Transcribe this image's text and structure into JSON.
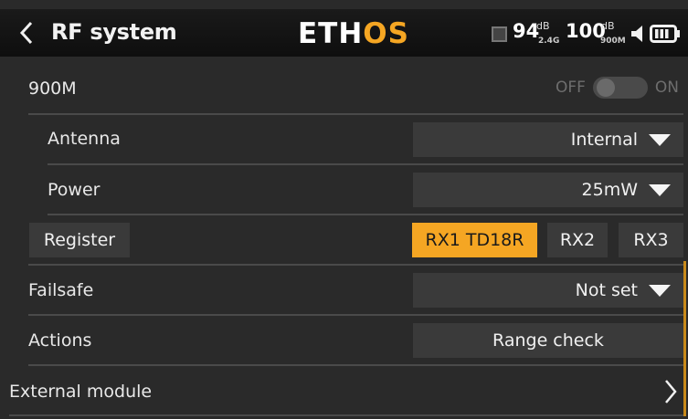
{
  "header": {
    "title": "RF system",
    "brand_a": "ETH",
    "brand_b": "OS",
    "rssi_1_value": "94",
    "rssi_1_unit": "dB",
    "rssi_1_sub": "2.4G",
    "rssi_2_value": "100",
    "rssi_2_unit": "dB",
    "rssi_2_sub": "900M"
  },
  "module_900m": {
    "label": "900M",
    "toggle_off": "OFF",
    "toggle_on": "ON",
    "enabled": false
  },
  "antenna": {
    "label": "Antenna",
    "value": "Internal"
  },
  "power": {
    "label": "Power",
    "value": "25mW"
  },
  "register": {
    "button_label": "Register",
    "receivers": [
      "RX1 TD18R",
      "RX2",
      "RX3"
    ],
    "active_index": 0
  },
  "failsafe": {
    "label": "Failsafe",
    "value": "Not set"
  },
  "actions": {
    "label": "Actions",
    "button_label": "Range check"
  },
  "external": {
    "label": "External module"
  },
  "colors": {
    "accent": "#f5a623",
    "background": "#2a2a2a",
    "field": "#3a3a3a",
    "header": "#111111"
  }
}
